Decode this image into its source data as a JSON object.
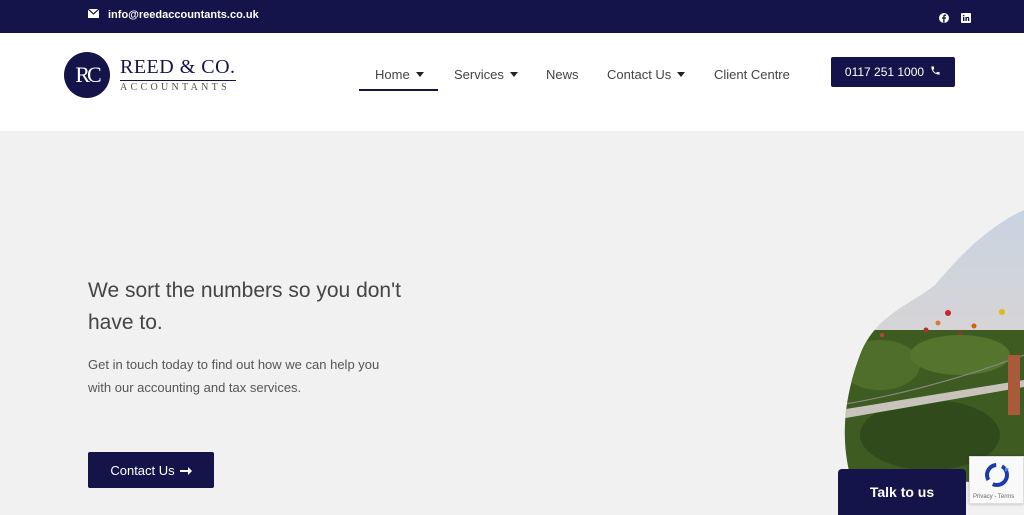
{
  "topbar": {
    "email": "info@reedaccountants.co.uk",
    "icons": [
      "envelope-icon",
      "facebook-icon",
      "linkedin-icon"
    ]
  },
  "logo": {
    "mark": "RC",
    "name": "REED & CO.",
    "sub": "ACCOUNTANTS"
  },
  "nav": {
    "items": [
      {
        "label": "Home",
        "active": true
      },
      {
        "label": "Services"
      },
      {
        "label": "News"
      },
      {
        "label": "Contact Us"
      },
      {
        "label": "Client Centre"
      }
    ]
  },
  "phone": {
    "label": "0117 251 1000",
    "icon": "phone-icon"
  },
  "hero": {
    "title": "We sort the numbers so you don't have to.",
    "text": "Get in touch today to find out how we can help you with our accounting and tax services.",
    "cta_label": "Contact Us",
    "cta_icon": "arrow-right-icon"
  },
  "talk": {
    "label": "Talk to us"
  },
  "recaptcha": {
    "label": "Privacy - Terms"
  },
  "colors": {
    "navy": "#14144a",
    "background": "#f1f1f1"
  }
}
